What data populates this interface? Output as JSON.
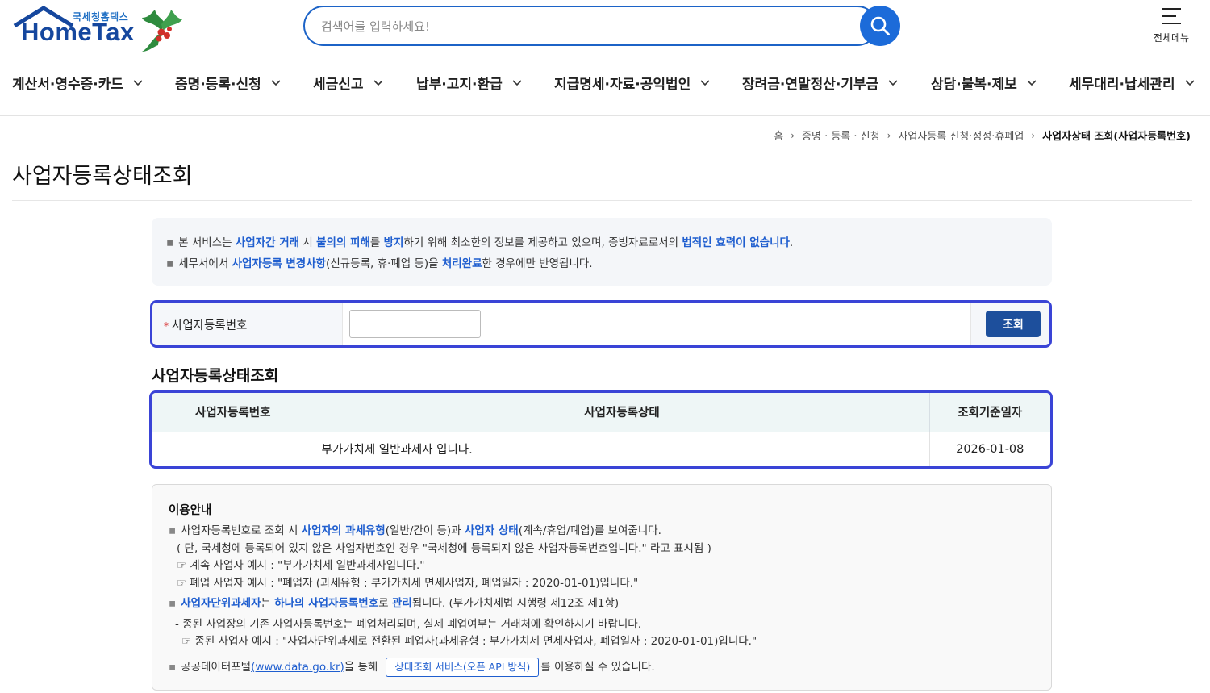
{
  "header": {
    "logo_sub": "국세청홈택스",
    "logo_main": "HomeTax",
    "search_placeholder": "검색어를 입력하세요!",
    "allmenu_label": "전체메뉴"
  },
  "gnb": {
    "items": [
      "계산서·영수증·카드",
      "증명·등록·신청",
      "세금신고",
      "납부·고지·환급",
      "지급명세·자료·공익법인",
      "장려금·연말정산·기부금",
      "상담·불복·제보",
      "세무대리·납세관리"
    ]
  },
  "breadcrumb": {
    "home": "홈",
    "level1": "증명 · 등록 · 신청",
    "level2": "사업자등록 신청·정정·휴폐업",
    "current": "사업자상태 조회(사업자등록번호)"
  },
  "page": {
    "title": "사업자등록상태조회"
  },
  "notice": {
    "line1": {
      "p1": "본 서비스는 ",
      "h1": "사업자간 거래",
      "p2": " 시 ",
      "h2": "불의의 피해",
      "p3": "를 ",
      "h3": "방지",
      "p4": "하기 위해 최소한의 정보를 제공하고 있으며, 증빙자료로서의 ",
      "h4": "법적인 효력이 없습니다",
      "p5": "."
    },
    "line2": {
      "p1": "세무서에서 ",
      "h1": "사업자등록 변경사항",
      "p2": "(신규등록, 휴·폐업 등)을 ",
      "h2": "처리완료",
      "p3": "한 경우에만 반영됩니다."
    }
  },
  "form": {
    "label": "사업자등록번호",
    "required_mark": "*",
    "input_value": "",
    "button": "조회"
  },
  "result": {
    "section_title": "사업자등록상태조회",
    "columns": [
      "사업자등록번호",
      "사업자등록상태",
      "조회기준일자"
    ],
    "row": {
      "number": "",
      "status": "부가가치세 일반과세자 입니다.",
      "date": "2026-01-08"
    }
  },
  "guide": {
    "title": "이용안내",
    "l1": {
      "p1": "사업자등록번호로 조회 시 ",
      "h1": "사업자의 과세유형",
      "p2": "(일반/간이 등)과 ",
      "h2": "사업자 상태",
      "p3": "(계속/휴업/폐업)를 보여줍니다."
    },
    "l2": "( 단, 국세청에 등록되어 있지 않은 사업자번호인 경우 \"국세청에 등록되지 않은 사업자등록번호입니다.\" 라고 표시됨 )",
    "l3": "☞ 계속 사업자 예시 : \"부가가치세 일반과세자입니다.\"",
    "l4": "☞ 폐업 사업자 예시 : \"폐업자 (과세유형 : 부가가치세 면세사업자, 폐업일자 : 2020-01-01)입니다.\"",
    "l5": {
      "h1": "사업자단위과세자",
      "p1": "는 ",
      "h2": "하나의 사업자등록번호",
      "p2": "로 ",
      "h3": "관리",
      "p3": "됩니다. (부가가치세법 시행령 제12조 제1항)"
    },
    "l6": "- 종된 사업장의 기존 사업자등록번호는 폐업처리되며, 실제 폐업여부는 거래처에 확인하시기 바랍니다.",
    "l7": "☞ 종된 사업자 예시 : \"사업자단위과세로 전환된 폐업자(과세유형 : 부가가치세 면세사업자, 폐업일자 : 2020-01-01)입니다.\"",
    "l8": {
      "p1": "공공데이터포털",
      "link": "(www.data.go.kr)",
      "p2": "을 통해",
      "button": "상태조회 서비스(오픈 API 방식)",
      "p3": "를 이용하실 수 있습니다."
    }
  }
}
